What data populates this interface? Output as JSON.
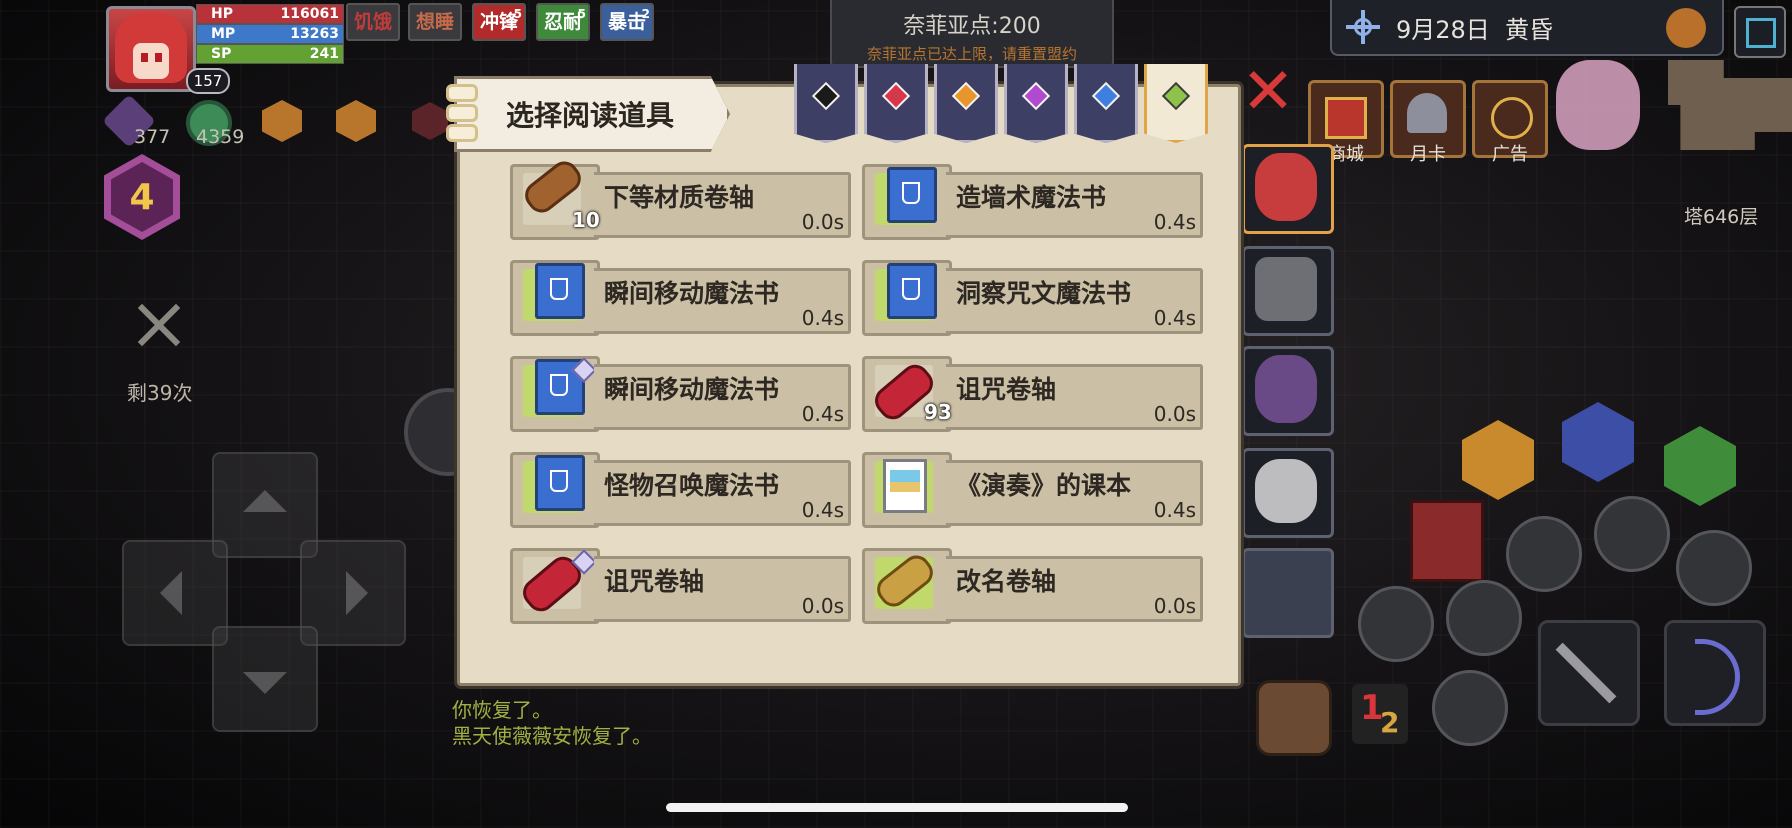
{
  "player": {
    "level_badge": "157",
    "hp_label": "HP",
    "hp_value": "116061",
    "mp_label": "MP",
    "mp_value": "13263",
    "sp_label": "SP",
    "sp_value": "241"
  },
  "buffs": [
    {
      "label": "饥饿",
      "count": ""
    },
    {
      "label": "想睡",
      "count": ""
    },
    {
      "label": "冲锋",
      "count": "5"
    },
    {
      "label": "忍耐",
      "count": "5"
    },
    {
      "label": "暴击",
      "count": "2"
    }
  ],
  "resources": [
    {
      "icon": "sword-gem-icon",
      "value": "377"
    },
    {
      "icon": "green-orb-icon",
      "value": "4359"
    }
  ],
  "level_hex": "4",
  "attack_remaining": "剩39次",
  "points": {
    "title": "奈菲亚点:200",
    "subtitle": "奈菲亚点已达上限，请重置盟约"
  },
  "datetime": {
    "date": "9月28日",
    "period": "黄昏"
  },
  "shop": [
    {
      "label": "商城"
    },
    {
      "label": "月卡"
    },
    {
      "label": "广告"
    }
  ],
  "floor": "塔646层",
  "modal": {
    "title": "选择阅读道具",
    "tabs": [
      {
        "icon": "black-gem-icon",
        "color": "#1a1a1a"
      },
      {
        "icon": "red-gem-icon",
        "color": "#d6374a"
      },
      {
        "icon": "orange-gem-icon",
        "color": "#e8962c"
      },
      {
        "icon": "purple-gem-icon",
        "color": "#b24ad0"
      },
      {
        "icon": "blue-gem-icon",
        "color": "#3f7fe0"
      },
      {
        "icon": "green-gem-icon",
        "color": "#8fc24a"
      }
    ],
    "items": [
      {
        "name": "下等材质卷轴",
        "time": "0.0s",
        "qty": "10",
        "icon": "brown-scroll-icon"
      },
      {
        "name": "造墙术魔法书",
        "time": "0.4s",
        "qty": "",
        "icon": "blue-spellbook-icon"
      },
      {
        "name": "瞬间移动魔法书",
        "time": "0.4s",
        "qty": "",
        "icon": "blue-spellbook-icon"
      },
      {
        "name": "洞察咒文魔法书",
        "time": "0.4s",
        "qty": "",
        "icon": "blue-spellbook-icon"
      },
      {
        "name": "瞬间移动魔法书",
        "time": "0.4s",
        "qty": "",
        "icon": "blue-spellbook-icon"
      },
      {
        "name": "诅咒卷轴",
        "time": "0.0s",
        "qty": "93",
        "icon": "red-scroll-icon"
      },
      {
        "name": "怪物召唤魔法书",
        "time": "0.4s",
        "qty": "",
        "icon": "blue-spellbook-icon"
      },
      {
        "name": "《演奏》的课本",
        "time": "0.4s",
        "qty": "",
        "icon": "textbook-icon"
      },
      {
        "name": "诅咒卷轴",
        "time": "0.0s",
        "qty": "",
        "icon": "red-scroll-icon"
      },
      {
        "name": "改名卷轴",
        "time": "0.0s",
        "qty": "",
        "icon": "gold-scroll-icon"
      }
    ]
  },
  "log": [
    "你恢复了。",
    "黑天使薇薇安恢复了。"
  ]
}
